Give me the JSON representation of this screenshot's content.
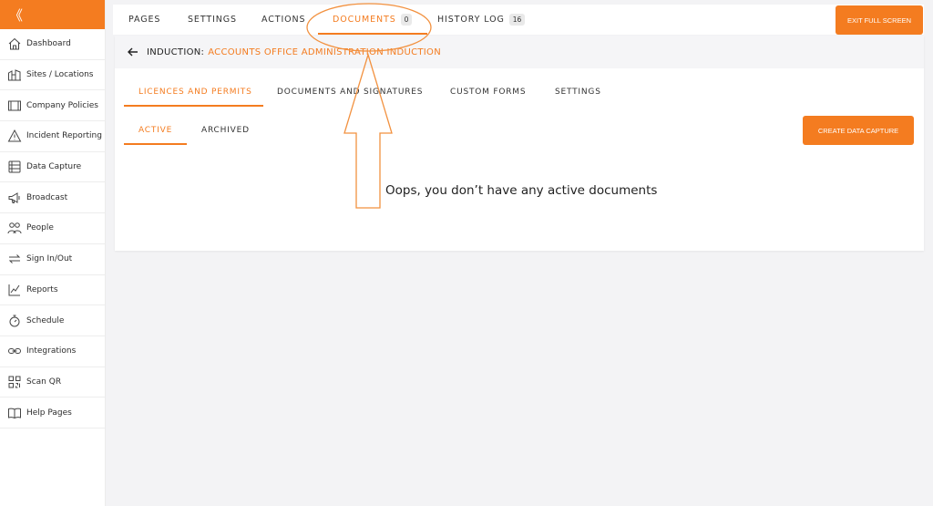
{
  "sidebar": {
    "collapse_glyph": "《",
    "items": [
      {
        "label": "Dashboard",
        "icon": "home-icon"
      },
      {
        "label": "Sites / Locations",
        "icon": "buildings-icon"
      },
      {
        "label": "Company Policies",
        "icon": "policy-book-icon"
      },
      {
        "label": "Incident Reporting",
        "icon": "warning-triangle-icon"
      },
      {
        "label": "Data Capture",
        "icon": "data-capture-icon"
      },
      {
        "label": "Broadcast",
        "icon": "megaphone-icon"
      },
      {
        "label": "People",
        "icon": "people-icon"
      },
      {
        "label": "Sign In/Out",
        "icon": "swap-arrows-icon"
      },
      {
        "label": "Reports",
        "icon": "line-chart-icon"
      },
      {
        "label": "Schedule",
        "icon": "stopwatch-icon"
      },
      {
        "label": "Integrations",
        "icon": "link-icon"
      },
      {
        "label": "Scan QR",
        "icon": "qr-code-icon"
      },
      {
        "label": "Help Pages",
        "icon": "open-book-icon"
      }
    ]
  },
  "topbar": {
    "tabs": [
      {
        "label": "PAGES"
      },
      {
        "label": "SETTINGS"
      },
      {
        "label": "ACTIONS"
      },
      {
        "label": "DOCUMENTS",
        "badge": "0"
      },
      {
        "label": "HISTORY LOG",
        "badge": "16"
      }
    ],
    "active_tab": "DOCUMENTS",
    "exit_label": "EXIT FULL SCREEN"
  },
  "breadcrumb": {
    "label": "INDUCTION:",
    "value": "ACCOUNTS OFFICE ADMINISTRATION INDUCTION"
  },
  "section_tabs": [
    {
      "label": "LICENCES AND PERMITS"
    },
    {
      "label": "DOCUMENTS AND SIGNATURES"
    },
    {
      "label": "CUSTOM FORMS"
    },
    {
      "label": "SETTINGS"
    }
  ],
  "status_tabs": [
    {
      "label": "ACTIVE"
    },
    {
      "label": "ARCHIVED"
    }
  ],
  "create_label": "CREATE DATA CAPTURE",
  "empty_message": "Oops, you don’t have any active documents",
  "colors": {
    "accent": "#f47c20",
    "background": "#f3f3f5",
    "text": "#333333"
  }
}
